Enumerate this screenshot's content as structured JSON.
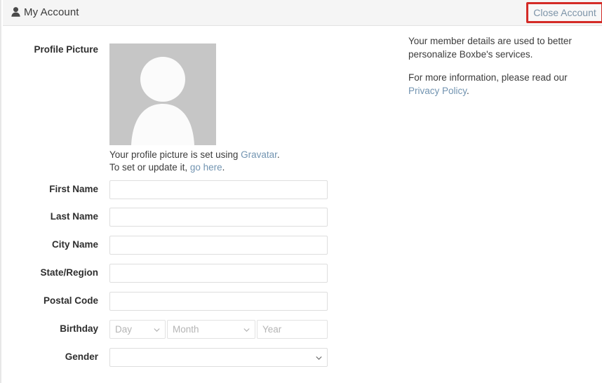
{
  "header": {
    "icon": "user-icon",
    "title": "My Account",
    "close_account_label": "Close Account"
  },
  "profile": {
    "label": "Profile Picture",
    "avatar_icon": "person-silhouette-icon",
    "avatar_bg_color": "#c6c6c6",
    "caption_line1_prefix": "Your profile picture is set using ",
    "caption_line1_link": "Gravatar",
    "caption_line1_suffix": ".",
    "caption_line2_prefix": "To set or update it, ",
    "caption_line2_link": "go here",
    "caption_line2_suffix": "."
  },
  "form": {
    "fields": [
      {
        "label": "First Name",
        "value": "",
        "placeholder": "",
        "type": "text"
      },
      {
        "label": "Last Name",
        "value": "",
        "placeholder": "",
        "type": "text"
      },
      {
        "label": "City Name",
        "value": "",
        "placeholder": "",
        "type": "text"
      },
      {
        "label": "State/Region",
        "value": "",
        "placeholder": "",
        "type": "text"
      },
      {
        "label": "Postal Code",
        "value": "",
        "placeholder": "",
        "type": "text"
      }
    ],
    "birthday": {
      "label": "Birthday",
      "day_selected": "Day",
      "month_selected": "Month",
      "year_placeholder": "Year",
      "year_value": ""
    },
    "gender": {
      "label": "Gender",
      "selected": ""
    }
  },
  "info": {
    "paragraph1": "Your member details are used to better personalize Boxbe's services.",
    "paragraph2_prefix": "For more information, please read our ",
    "paragraph2_link": "Privacy Policy",
    "paragraph2_suffix": "."
  },
  "colors": {
    "annotation_red": "#d42b27",
    "link_blue": "#7294b1",
    "header_bg": "#f5f5f5"
  }
}
